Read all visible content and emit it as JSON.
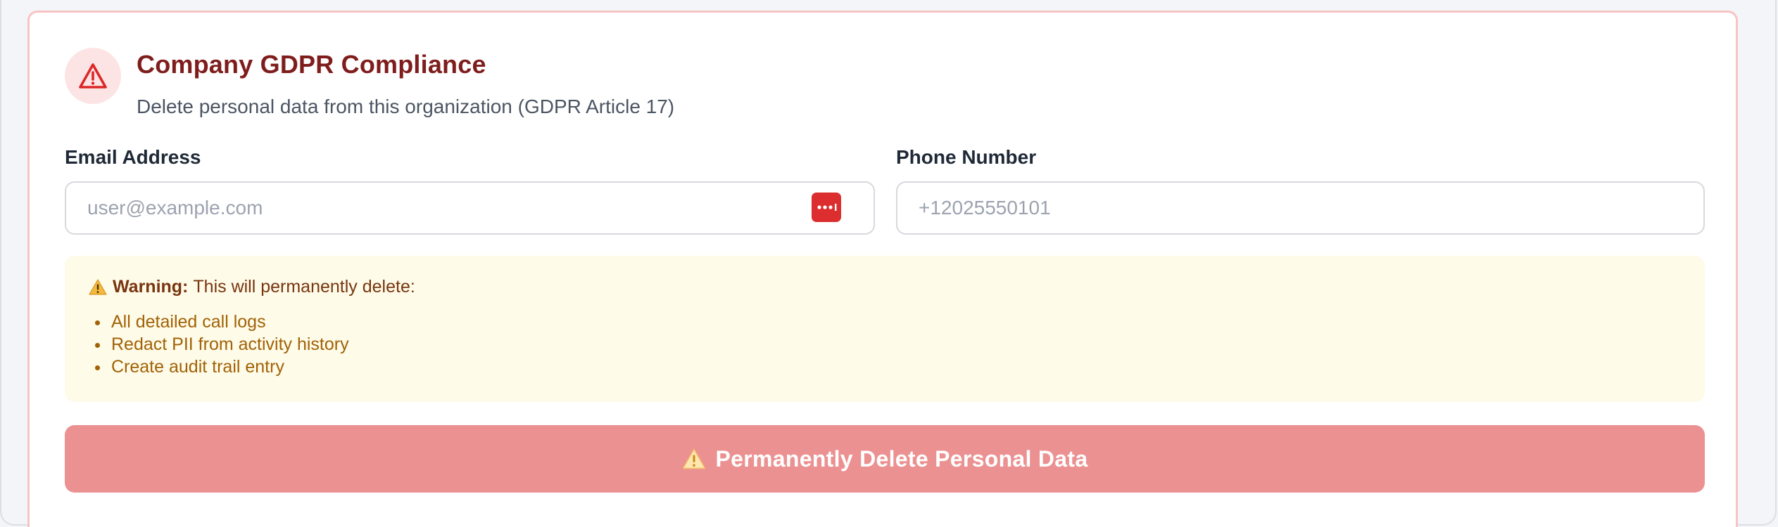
{
  "header": {
    "title": "Company GDPR Compliance",
    "subtitle": "Delete personal data from this organization (GDPR Article 17)",
    "icon": "alert-triangle-icon"
  },
  "form": {
    "email": {
      "label": "Email Address",
      "placeholder": "user@example.com",
      "value": ""
    },
    "phone": {
      "label": "Phone Number",
      "placeholder": "+12025550101",
      "value": ""
    }
  },
  "warning": {
    "prefix": "Warning:",
    "text": "This will permanently delete:",
    "items": [
      "All detailed call logs",
      "Redact PII from activity history",
      "Create audit trail entry"
    ]
  },
  "action": {
    "delete_label": "Permanently Delete Personal Data"
  },
  "colors": {
    "title": "#7f1d1d",
    "danger": "#dc2e2e",
    "button_bg": "#ec9191",
    "warning_bg": "#fefbe8",
    "warning_text": "#a16207",
    "card_border": "#f7c4c4"
  }
}
